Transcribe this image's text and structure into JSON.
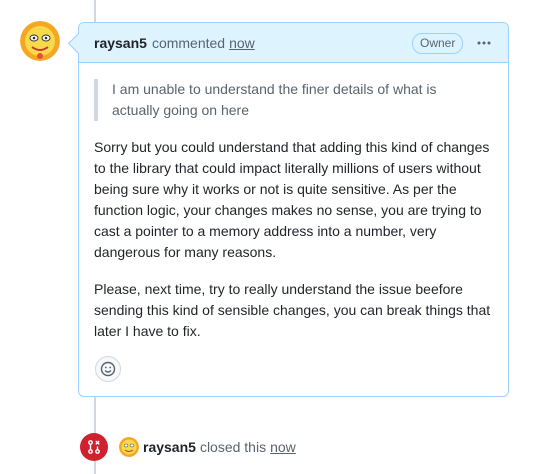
{
  "comment": {
    "author": "raysan5",
    "action": "commented",
    "time": "now",
    "badge": "Owner",
    "menu_icon": "kebab-horizontal-icon",
    "quote": "I am unable to understand the finer details of what is actually going on here",
    "paragraphs": [
      "Sorry but you could understand that adding this kind of changes to the library that could impact literally millions of users without being sure why it works or not is quite sensitive. As per the function logic, your changes makes no sense, you are trying to cast a pointer to a memory address into a number, very dangerous for many reasons.",
      "Please, next time, try to really understand the issue beefore sending this kind of sensible changes, you can break things that later I have to fix."
    ],
    "reaction_icon": "smiley-icon"
  },
  "event": {
    "icon": "git-pull-request-closed-icon",
    "author": "raysan5",
    "text": "closed this",
    "time": "now"
  },
  "colors": {
    "header_bg": "#ddf4ff",
    "border": "#9cd0ff",
    "closed_red": "#cf222e",
    "muted_text": "#59636e"
  }
}
